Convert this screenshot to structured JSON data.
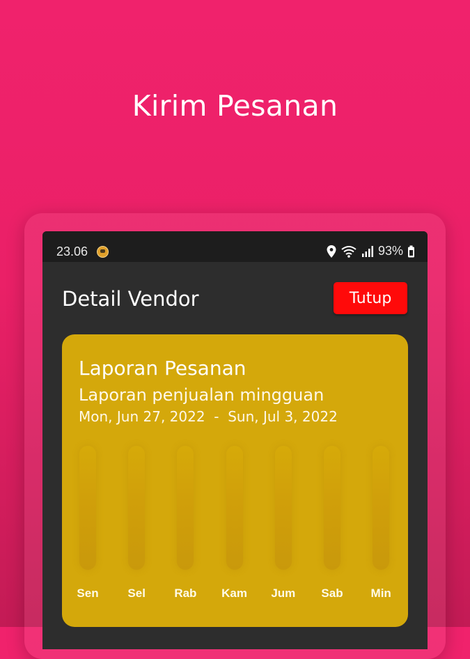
{
  "headline": "Kirim Pesanan",
  "status_bar": {
    "time": "23.06",
    "battery": "93%",
    "icons": [
      "app-avatar-icon",
      "location-pin-icon",
      "wifi-icon",
      "signal-icon",
      "battery-icon"
    ]
  },
  "header": {
    "title": "Detail Vendor",
    "close_label": "Tutup"
  },
  "card": {
    "title": "Laporan Pesanan",
    "subtitle": "Laporan penjualan mingguan",
    "dates": "Mon, Jun 27, 2022  -  Sun, Jul 3, 2022"
  },
  "colors": {
    "background": "#f0226c",
    "panel": "#2d2d2d",
    "card": "#d4a80b",
    "close_button": "#ff0a0a"
  },
  "chart_data": {
    "type": "bar",
    "categories": [
      "Sen",
      "Sel",
      "Rab",
      "Kam",
      "Jum",
      "Sab",
      "Min"
    ],
    "values": [
      0,
      0,
      0,
      0,
      0,
      0,
      0
    ],
    "title": "",
    "xlabel": "",
    "ylabel": ""
  }
}
